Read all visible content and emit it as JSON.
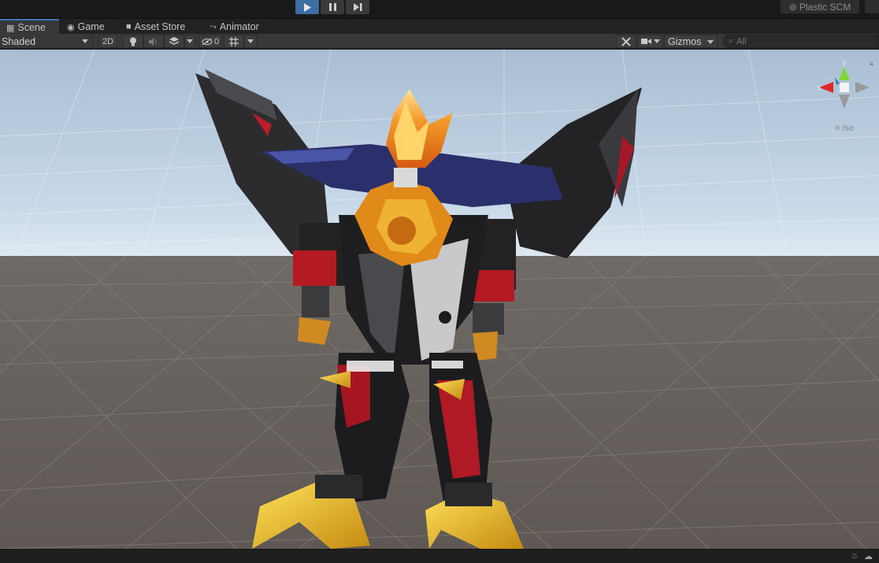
{
  "toolbar": {
    "play_icon": "play-icon",
    "pause_icon": "pause-icon",
    "step_icon": "step-icon",
    "plastic_label": "Plastic SCM",
    "plastic_icon": "plastic-scm-icon",
    "cloud_icon": "cloud-icon",
    "play_active_color": "#3d6ea3"
  },
  "tabs": [
    {
      "label": "Scene",
      "icon": "scene-grid-icon",
      "active": true
    },
    {
      "label": "Game",
      "icon": "game-controller-icon",
      "active": false
    },
    {
      "label": "Asset Store",
      "icon": "asset-store-bag-icon",
      "active": false
    },
    {
      "label": "Animator",
      "icon": "animator-icon",
      "active": false
    }
  ],
  "scene_toolbar": {
    "draw_mode": "Shaded",
    "mode_2d": "2D",
    "lighting_icon": "lightbulb-icon",
    "audio_icon": "audio-icon",
    "effects_icon": "effects-layers-icon",
    "hidden_count": "0",
    "hidden_icon": "eye-hidden-icon",
    "grid_icon": "grid-icon",
    "tools_icon": "tools-icon",
    "camera_icon": "camera-icon",
    "gizmos_label": "Gizmos",
    "search_placeholder": "All",
    "search_icon": "search-icon"
  },
  "viewport": {
    "orientation_gizmo": {
      "y_label": "y",
      "x_label": "x"
    },
    "projection_label": "Iso",
    "sky_color": "#b7cde2",
    "ground_color": "#6a6360"
  },
  "status": {
    "lock_icon": "lock-icon",
    "cloud_icon": "cloud-icon"
  }
}
